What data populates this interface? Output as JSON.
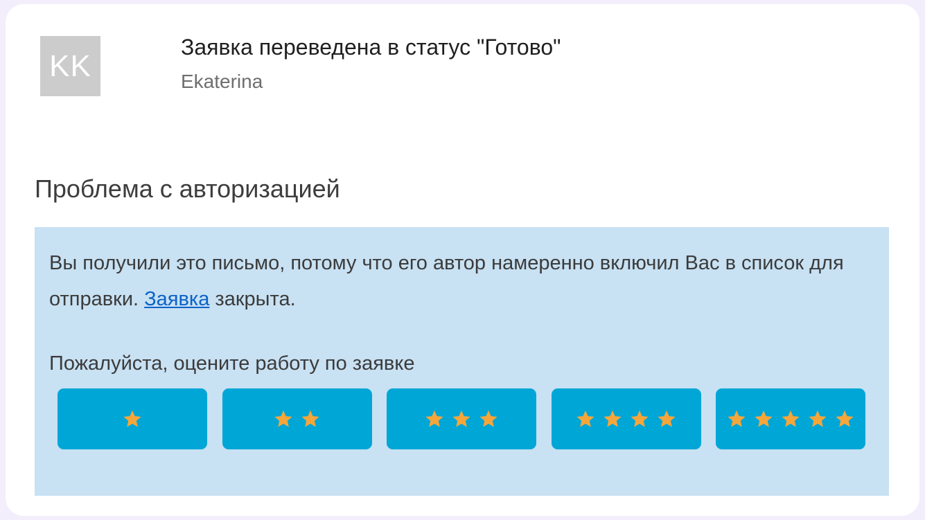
{
  "header": {
    "avatar_initials": "KK",
    "subject": "Заявка переведена в статус \"Готово\"",
    "sender": "Ekaterina"
  },
  "ticket": {
    "title": "Проблема с авторизацией"
  },
  "message": {
    "text_before_link": "Вы получили это письмо, потому что его автор намеренно включил Вас в список для отправки. ",
    "link_text": "Заявка",
    "text_after_link": " закрыта."
  },
  "rating": {
    "prompt": "Пожалуйста, оцените работу по заявке",
    "options": [
      {
        "stars": 1
      },
      {
        "stars": 2
      },
      {
        "stars": 3
      },
      {
        "stars": 4
      },
      {
        "stars": 5
      }
    ]
  },
  "colors": {
    "page_background": "#f3eefb",
    "card_background": "#ffffff",
    "avatar_background": "#cccccc",
    "panel_background": "#c8e1f3",
    "button_background": "#00a6d6",
    "star_color": "#f5a63b",
    "link_color": "#0a62c8"
  },
  "icons": {
    "rating_star": "star-icon"
  }
}
